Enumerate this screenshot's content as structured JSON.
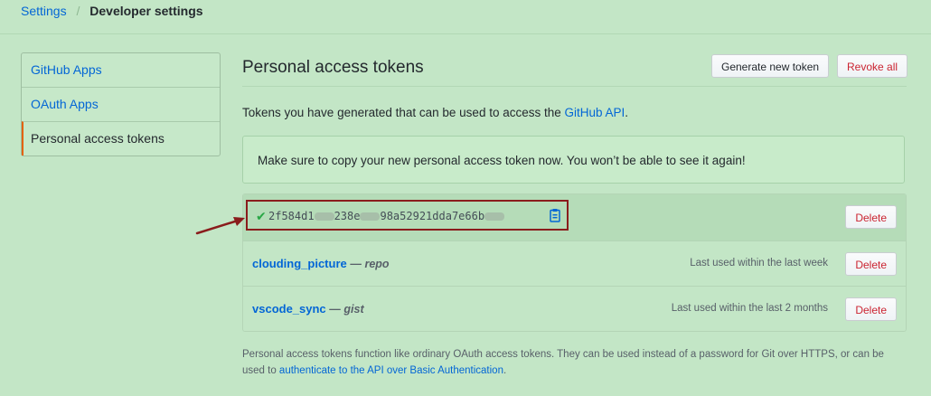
{
  "breadcrumb": {
    "parent": "Settings",
    "separator": "/",
    "current": "Developer settings"
  },
  "sidebar": {
    "items": [
      {
        "label": "GitHub Apps",
        "selected": false
      },
      {
        "label": "OAuth Apps",
        "selected": false
      },
      {
        "label": "Personal access tokens",
        "selected": true
      }
    ]
  },
  "header": {
    "title": "Personal access tokens",
    "generate_label": "Generate new token",
    "revoke_label": "Revoke all"
  },
  "intro": {
    "text_before": "Tokens you have generated that can be used to access the ",
    "link": "GitHub API",
    "text_after": "."
  },
  "flash": {
    "message": "Make sure to copy your new personal access token now. You won’t be able to see it again!"
  },
  "new_token": {
    "segments": [
      "2f584d1",
      "238e",
      "98a52921dda7e66b",
      ""
    ],
    "delete_label": "Delete",
    "icons": {
      "check": "check-icon",
      "copy": "clipboard-icon"
    }
  },
  "tokens": [
    {
      "name": "clouding_picture",
      "dash": "—",
      "scope": "repo",
      "last_used": "Last used within the last week",
      "delete_label": "Delete"
    },
    {
      "name": "vscode_sync",
      "dash": "—",
      "scope": "gist",
      "last_used": "Last used within the last 2 months",
      "delete_label": "Delete"
    }
  ],
  "footer": {
    "text_before": "Personal access tokens function like ordinary OAuth access tokens. They can be used instead of a password for Git over HTTPS, or can be used to ",
    "link": "authenticate to the API over Basic Authentication",
    "text_after": "."
  },
  "colors": {
    "background": "#c3e6c6",
    "link": "#0366d6",
    "danger": "#cb2431",
    "annotation": "#8a1c1c",
    "selected_accent": "#e36209"
  }
}
